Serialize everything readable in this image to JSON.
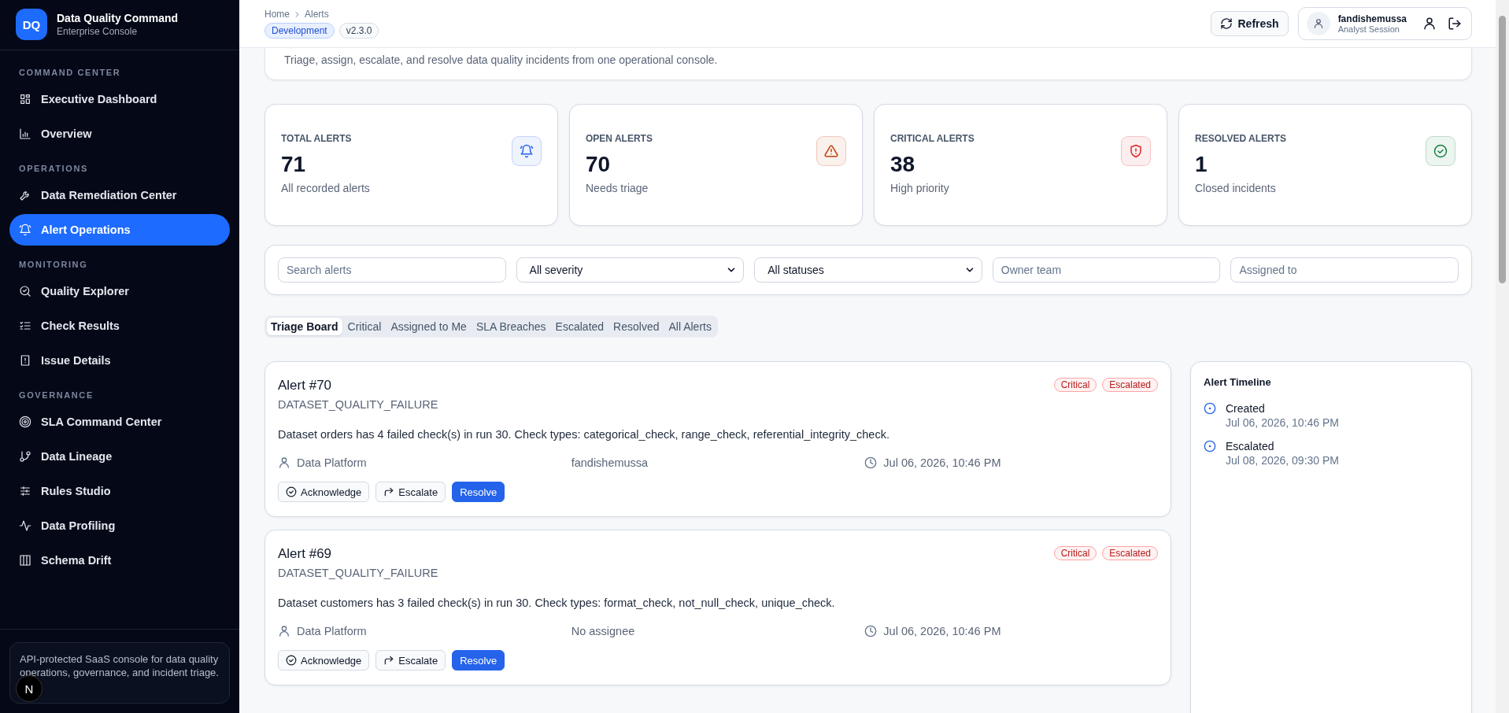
{
  "app": {
    "logo": "DQ",
    "name": "Data Quality Command",
    "subtitle": "Enterprise Console"
  },
  "sidebar": {
    "sections": [
      {
        "title": "COMMAND CENTER",
        "items": [
          {
            "label": "Executive Dashboard",
            "selected": false
          },
          {
            "label": "Overview",
            "selected": false
          }
        ]
      },
      {
        "title": "OPERATIONS",
        "items": [
          {
            "label": "Data Remediation Center",
            "selected": false
          },
          {
            "label": "Alert Operations",
            "selected": true
          }
        ]
      },
      {
        "title": "MONITORING",
        "items": [
          {
            "label": "Quality Explorer",
            "selected": false
          },
          {
            "label": "Check Results",
            "selected": false
          },
          {
            "label": "Issue Details",
            "selected": false
          }
        ]
      },
      {
        "title": "GOVERNANCE",
        "items": [
          {
            "label": "SLA Command Center",
            "selected": false
          },
          {
            "label": "Data Lineage",
            "selected": false
          },
          {
            "label": "Rules Studio",
            "selected": false
          },
          {
            "label": "Data Profiling",
            "selected": false
          },
          {
            "label": "Schema Drift",
            "selected": false
          }
        ]
      }
    ],
    "footer_note": "API-protected SaaS console for data quality operations, governance, and incident triage.",
    "dev_badge": "N"
  },
  "header": {
    "breadcrumb": [
      "Home",
      "Alerts"
    ],
    "environment": "Development",
    "version": "v2.3.0",
    "refresh_button": "Refresh",
    "user": {
      "name": "fandishemussa",
      "role": "Analyst Session"
    }
  },
  "intro": {
    "description": "Triage, assign, escalate, and resolve data quality incidents from one operational console."
  },
  "stats": [
    {
      "label": "TOTAL ALERTS",
      "value": "71",
      "caption": "All recorded alerts",
      "color": "#2563eb"
    },
    {
      "label": "OPEN ALERTS",
      "value": "70",
      "caption": "Needs triage",
      "color": "#c2410c"
    },
    {
      "label": "CRITICAL ALERTS",
      "value": "38",
      "caption": "High priority",
      "color": "#dc2626"
    },
    {
      "label": "RESOLVED ALERTS",
      "value": "1",
      "caption": "Closed incidents",
      "color": "#15803d"
    }
  ],
  "filters": [
    {
      "kind": "input",
      "placeholder": "Search alerts"
    },
    {
      "kind": "select",
      "value": "All severity"
    },
    {
      "kind": "select",
      "value": "All statuses"
    },
    {
      "kind": "input",
      "placeholder": "Owner team"
    },
    {
      "kind": "input",
      "placeholder": "Assigned to"
    }
  ],
  "tabs": [
    {
      "label": "Triage Board",
      "selected": true
    },
    {
      "label": "Critical",
      "selected": false
    },
    {
      "label": "Assigned to Me",
      "selected": false
    },
    {
      "label": "SLA Breaches",
      "selected": false
    },
    {
      "label": "Escalated",
      "selected": false
    },
    {
      "label": "Resolved",
      "selected": false
    },
    {
      "label": "All Alerts",
      "selected": false
    }
  ],
  "alerts": [
    {
      "title": "Alert #70",
      "type": "DATASET_QUALITY_FAILURE",
      "severity": "Critical",
      "status": "Escalated",
      "description": "Dataset orders has 4 failed check(s) in run 30. Check types: categorical_check, range_check, referential_integrity_check.",
      "owner_team": "Data Platform",
      "assignee": "fandishemussa",
      "time": "Jul 06, 2026, 10:46 PM",
      "actions": [
        {
          "kind": "acknowledge",
          "label": "Acknowledge"
        },
        {
          "kind": "escalate",
          "label": "Escalate"
        },
        {
          "kind": "resolve",
          "label": "Resolve"
        }
      ]
    },
    {
      "title": "Alert #69",
      "type": "DATASET_QUALITY_FAILURE",
      "severity": "Critical",
      "status": "Escalated",
      "description": "Dataset customers has 3 failed check(s) in run 30. Check types: format_check, not_null_check, unique_check.",
      "owner_team": "Data Platform",
      "assignee": "No assignee",
      "time": "Jul 06, 2026, 10:46 PM",
      "actions": [
        {
          "kind": "acknowledge",
          "label": "Acknowledge"
        },
        {
          "kind": "escalate",
          "label": "Escalate"
        },
        {
          "kind": "resolve",
          "label": "Resolve"
        }
      ]
    }
  ],
  "timeline": {
    "title": "Alert Timeline",
    "events": [
      {
        "label": "Created",
        "time": "Jul 06, 2026, 10:46 PM"
      },
      {
        "label": "Escalated",
        "time": "Jul 08, 2026, 09:30 PM"
      }
    ]
  }
}
